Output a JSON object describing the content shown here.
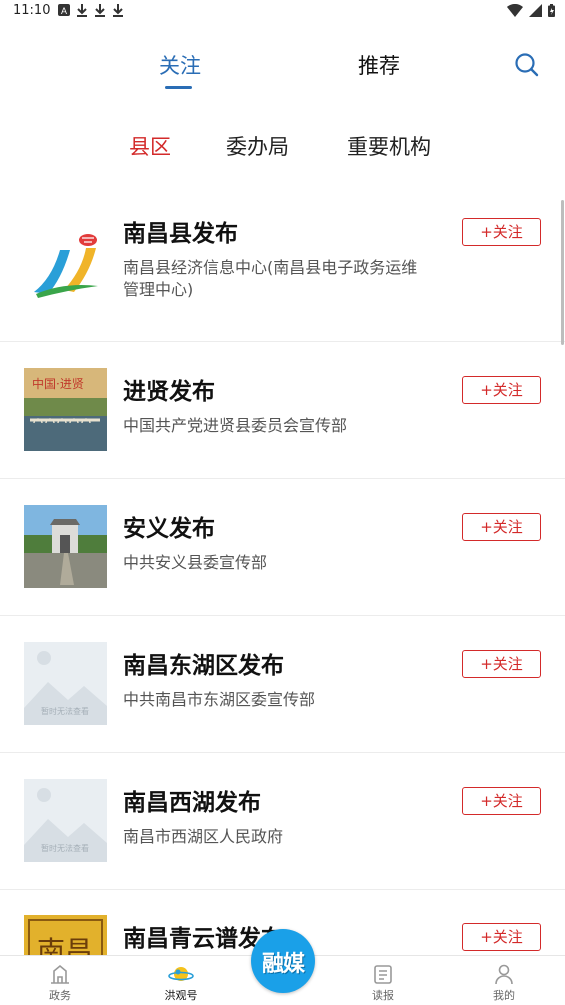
{
  "status_bar": {
    "time": "11:10",
    "icons": [
      "a-icon",
      "download-icon",
      "download-icon",
      "download-icon"
    ],
    "right_icons": [
      "wifi-icon",
      "signal-icon",
      "battery-icon"
    ]
  },
  "top_tabs": [
    {
      "label": "关注",
      "active": true
    },
    {
      "label": "推荐",
      "active": false
    }
  ],
  "sub_tabs": [
    {
      "label": "县区",
      "active": true
    },
    {
      "label": "委办局",
      "active": false
    },
    {
      "label": "重要机构",
      "active": false
    }
  ],
  "follow_label": "+关注",
  "items": [
    {
      "title": "南昌县发布",
      "desc": "南昌县经济信息中心(南昌县电子政务运维管理中心)",
      "thumb": "nanchang-county-logo"
    },
    {
      "title": "进贤发布",
      "desc": "中国共产党进贤县委员会宣传部",
      "thumb": "jinxian-bridge-photo",
      "thumb_text": "中国·进贤"
    },
    {
      "title": "安义发布",
      "desc": "中共安义县委宣传部",
      "thumb": "anyi-gate-photo"
    },
    {
      "title": "南昌东湖区发布",
      "desc": "中共南昌市东湖区委宣传部",
      "thumb": "placeholder-image",
      "thumb_text": "暂时无法查看"
    },
    {
      "title": "南昌西湖发布",
      "desc": "南昌市西湖区人民政府",
      "thumb": "placeholder-image",
      "thumb_text": "暂时无法查看"
    },
    {
      "title": "南昌青云谱发布",
      "desc": "",
      "thumb": "qingyunpu-logo",
      "thumb_text": "南昌"
    }
  ],
  "bottom_nav": [
    {
      "label": "政务",
      "icon": "government-icon"
    },
    {
      "label": "洪观号",
      "icon": "planet-icon",
      "active": true
    },
    {
      "label": "读报",
      "icon": "newspaper-icon"
    },
    {
      "label": "我的",
      "icon": "user-icon"
    }
  ],
  "center_button": {
    "label": "融媒"
  },
  "colors": {
    "accent_blue": "#2a6db5",
    "accent_red": "#d32a2a",
    "center_button": "#1aa0e8"
  }
}
